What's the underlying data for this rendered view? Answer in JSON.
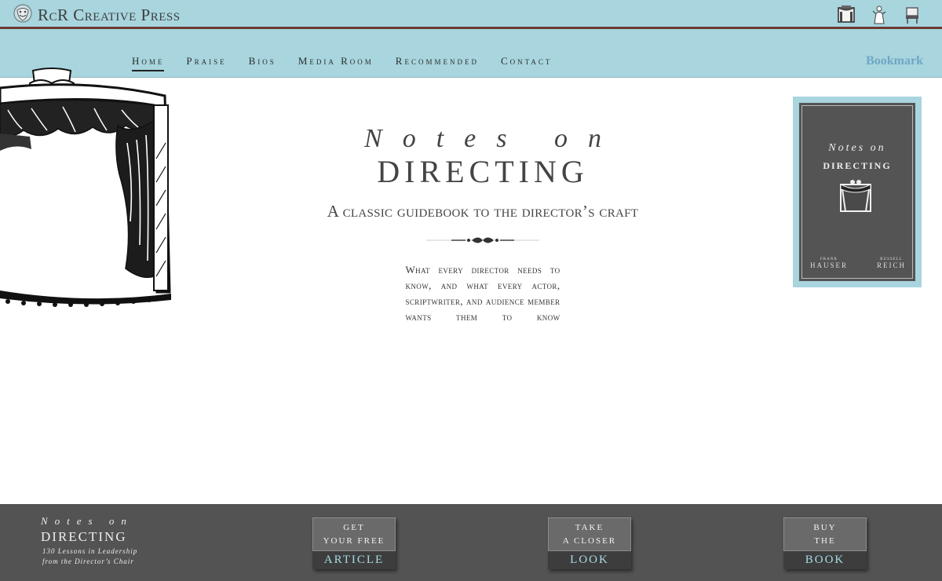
{
  "header": {
    "brand": "RcR Creative Press",
    "icons": [
      "stage-icon",
      "actor-icon",
      "chair-icon"
    ],
    "bookmark": "Bookmark"
  },
  "nav": {
    "items": [
      "Home",
      "Praise",
      "Bios",
      "Media Room",
      "Recommended",
      "Contact"
    ],
    "active": "Home"
  },
  "hero": {
    "notes": "Notes on",
    "directing": "DIRECTING",
    "subtitle": "A classic guidebook to the director’s craft",
    "tagline": "What every director needs to know, and what every actor, scriptwriter, and audience member wants them to know"
  },
  "cover": {
    "notes": "Notes on",
    "directing": "DIRECTING",
    "author1_first": "FRANK",
    "author1_last": "HAUSER",
    "author2_first": "RUSSELL",
    "author2_last": "REICH"
  },
  "footer": {
    "notes": "Notes on",
    "directing": "DIRECTING",
    "lessons_line1": "130 Lessons in Leadership",
    "lessons_line2": "from the Director’s Chair",
    "cta": [
      {
        "line1": "GET",
        "line2": "YOUR FREE",
        "bottom": "ARTICLE"
      },
      {
        "line1": "TAKE",
        "line2": "A CLOSER",
        "bottom": "LOOK"
      },
      {
        "line1": "BUY",
        "line2": "THE",
        "bottom": "BOOK"
      }
    ]
  },
  "colors": {
    "header_bg": "#a8d5de",
    "header_rule": "#6b3a33",
    "bookmark": "#6ea7c6",
    "footer_bg": "#535353",
    "cta_accent": "#a6dbe5"
  }
}
